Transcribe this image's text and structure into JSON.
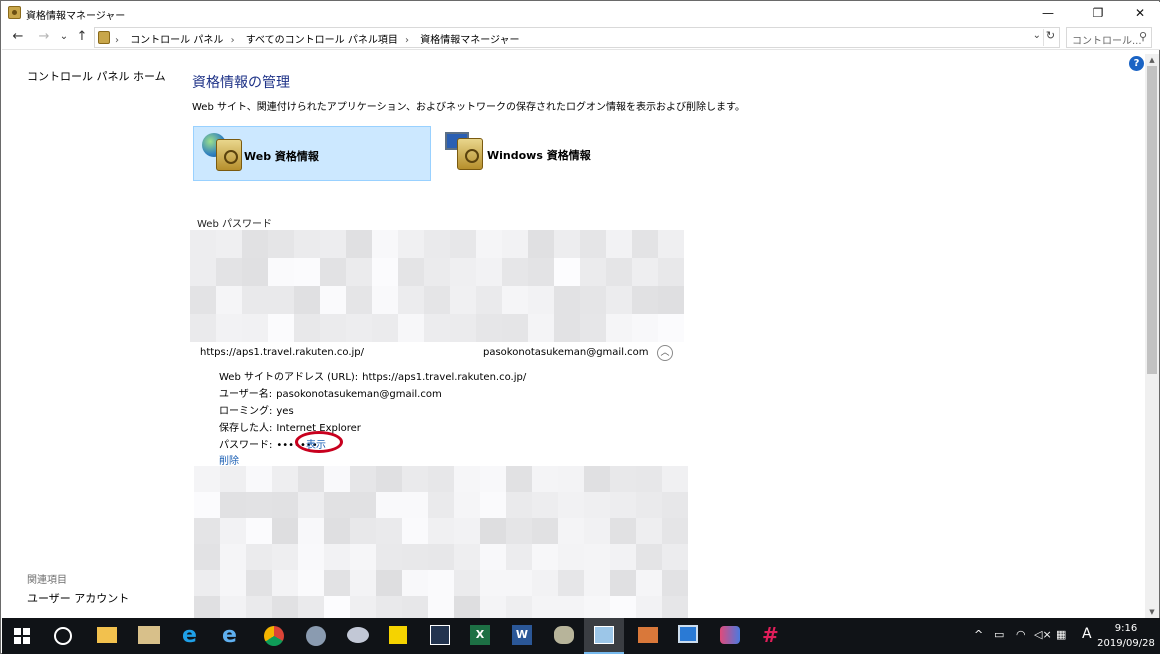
{
  "window": {
    "title": "資格情報マネージャー",
    "minimize": "—",
    "restore": "❐",
    "close": "✕"
  },
  "nav": {
    "back": "←",
    "forward": "→",
    "recent": "⌄",
    "up": "↑",
    "breadcrumbs": [
      "コントロール パネル",
      "すべてのコントロール パネル項目",
      "資格情報マネージャー"
    ],
    "dropdown": "⌄",
    "refresh": "↻",
    "search_placeholder": "コントロール...",
    "search_icon": "⚲"
  },
  "sidebar": {
    "home_link": "コントロール パネル ホーム",
    "related_heading": "関連項目",
    "user_accounts": "ユーザー アカウント"
  },
  "main": {
    "title": "資格情報の管理",
    "description": "Web サイト、関連付けられたアプリケーション、およびネットワークの保存されたログオン情報を表示および削除します。",
    "categories": [
      {
        "label": "Web 資格情報",
        "selected": true,
        "icon": "web-credential-icon"
      },
      {
        "label": "Windows 資格情報",
        "selected": false,
        "icon": "windows-credential-icon"
      }
    ],
    "section_label": "Web パスワード",
    "entry": {
      "url": "https://aps1.travel.rakuten.co.jp/",
      "user": "pasokonotasukeman@gmail.com",
      "details": [
        {
          "key": "Web サイトのアドレス (URL):",
          "value": "https://aps1.travel.rakuten.co.jp/"
        },
        {
          "key": "ユーザー名:",
          "value": "pasokonotasukeman@gmail.com"
        },
        {
          "key": "ローミング:",
          "value": "yes"
        },
        {
          "key": "保存した人:",
          "value": "Internet Explorer"
        },
        {
          "key": "パスワード:",
          "value": "•••••••"
        }
      ],
      "show_link": "表示",
      "delete_link": "削除"
    },
    "help": "?"
  },
  "taskbar": {
    "tray_input": "A",
    "time": "9:16",
    "date": "2019/09/28"
  },
  "colors": {
    "accent_title": "#1e3287",
    "link": "#1a5fb4",
    "selected_tile": "#cce8ff",
    "highlight_oval": "#c8001e",
    "taskbar": "#101317"
  }
}
